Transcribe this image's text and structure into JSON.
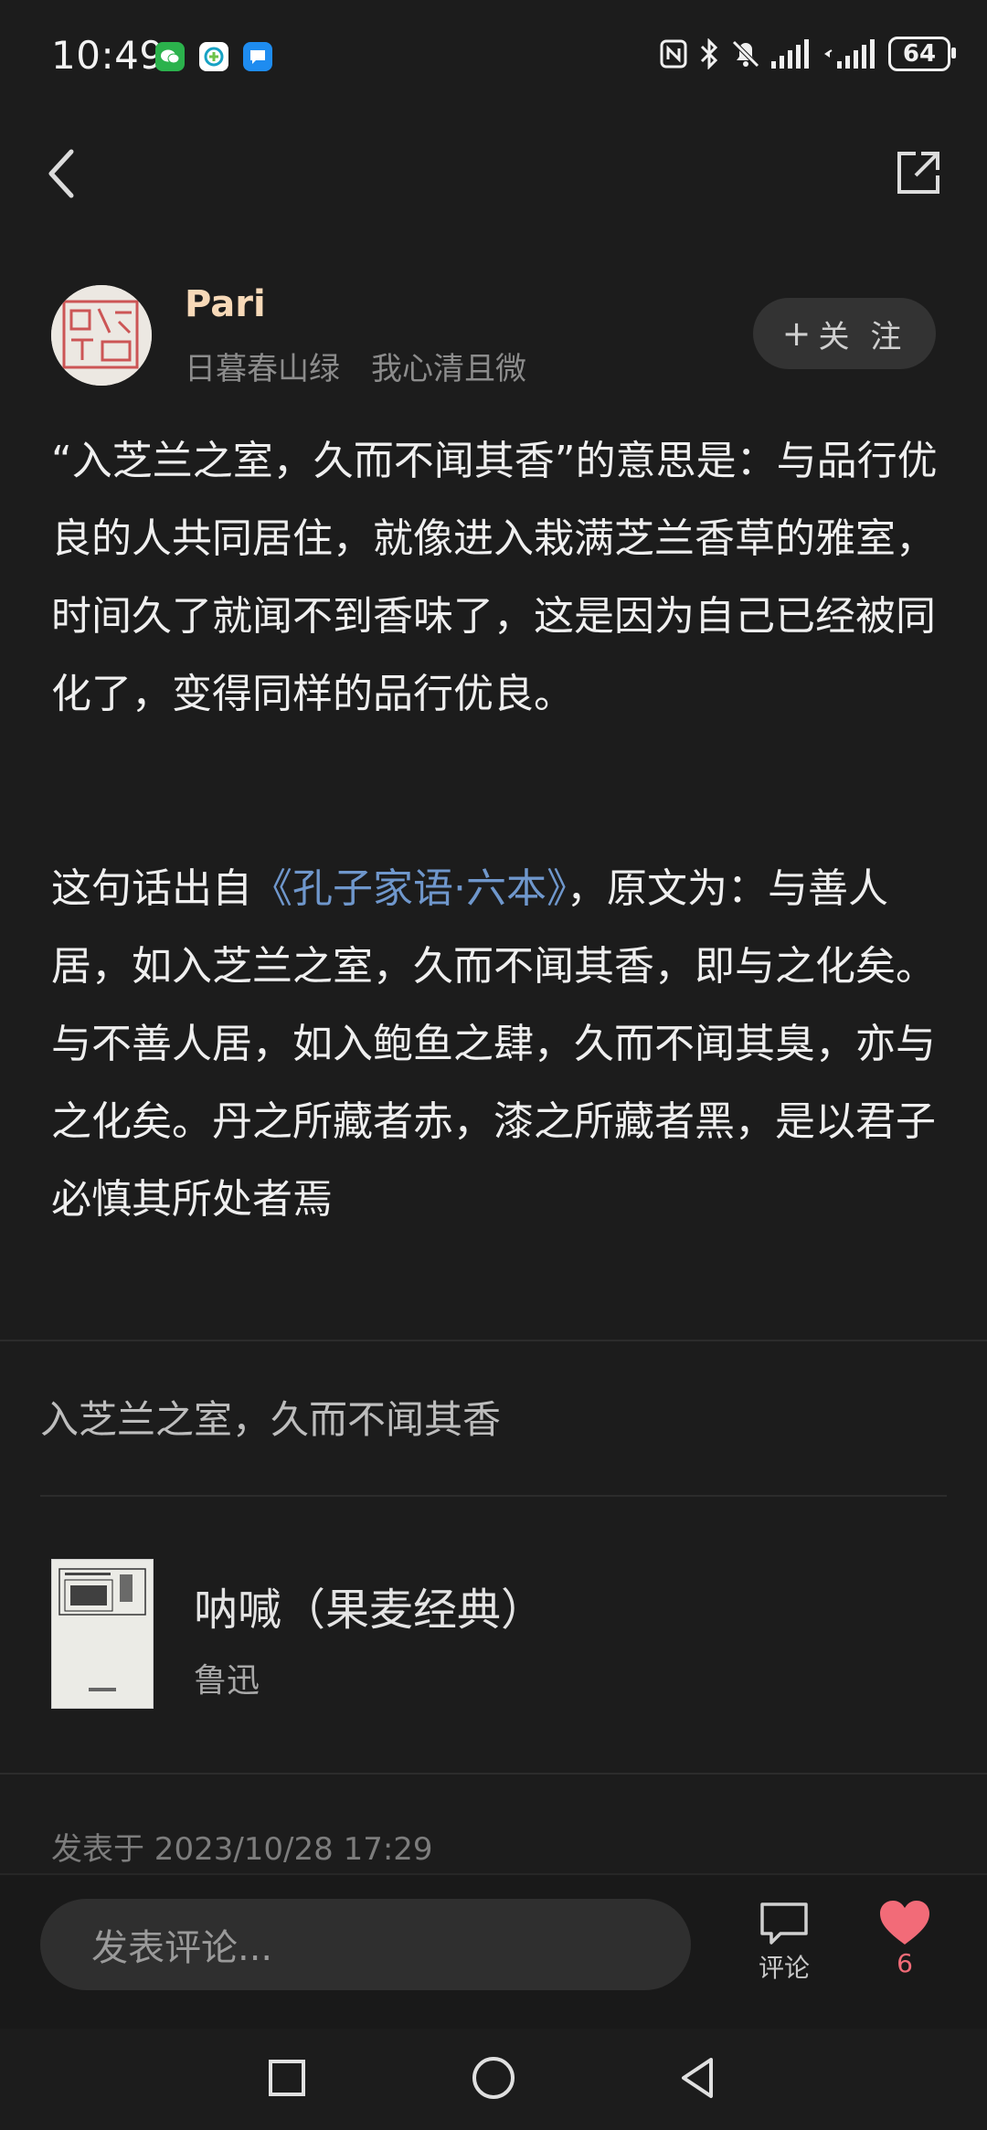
{
  "status_bar": {
    "time": "10:49",
    "battery": "64",
    "app_icons": [
      "wechat-icon",
      "app-icon",
      "chat-icon"
    ],
    "system_icons": [
      "nfc-icon",
      "bluetooth-icon",
      "mute-icon",
      "signal-icon",
      "signal-icon"
    ]
  },
  "header": {
    "back_icon": "chevron-left-icon",
    "share_icon": "share-icon"
  },
  "author": {
    "name": "Pari",
    "signature": "日暮春山绿　我心清且微",
    "follow_label": "关 注"
  },
  "content": {
    "paragraph1": "“入芝兰之室，久而不闻其香”的意思是：与品行优良的人共同居住，就像进入栽满芝兰香草的雅室，时间久了就闻不到香味了，这是因为自己已经被同化了，变得同样的品行优良。",
    "paragraph2_prefix": "这句话出自",
    "paragraph2_link": "《孔子家语·六本》",
    "paragraph2_rest": "，原文为：与善人居，如入芝兰之室，久而不闻其香，即与之化矣。与不善人居，如入鲍鱼之肆，久而不闻其臭，亦与之化矣。丹之所藏者赤，漆之所藏者黑，是以君子必慎其所处者焉"
  },
  "quote": "入芝兰之室，久而不闻其香",
  "book": {
    "title": "呐喊（果麦经典）",
    "author": "鲁迅"
  },
  "posted": "发表于 2023/10/28 17:29",
  "bottom": {
    "comment_placeholder": "发表评论...",
    "comment_label": "评论",
    "like_count": "6",
    "like_color": "#f26b78"
  },
  "colors": {
    "accent_link": "#6f97cc",
    "author_name": "#f7d9b8",
    "background": "#1c1c1c"
  }
}
